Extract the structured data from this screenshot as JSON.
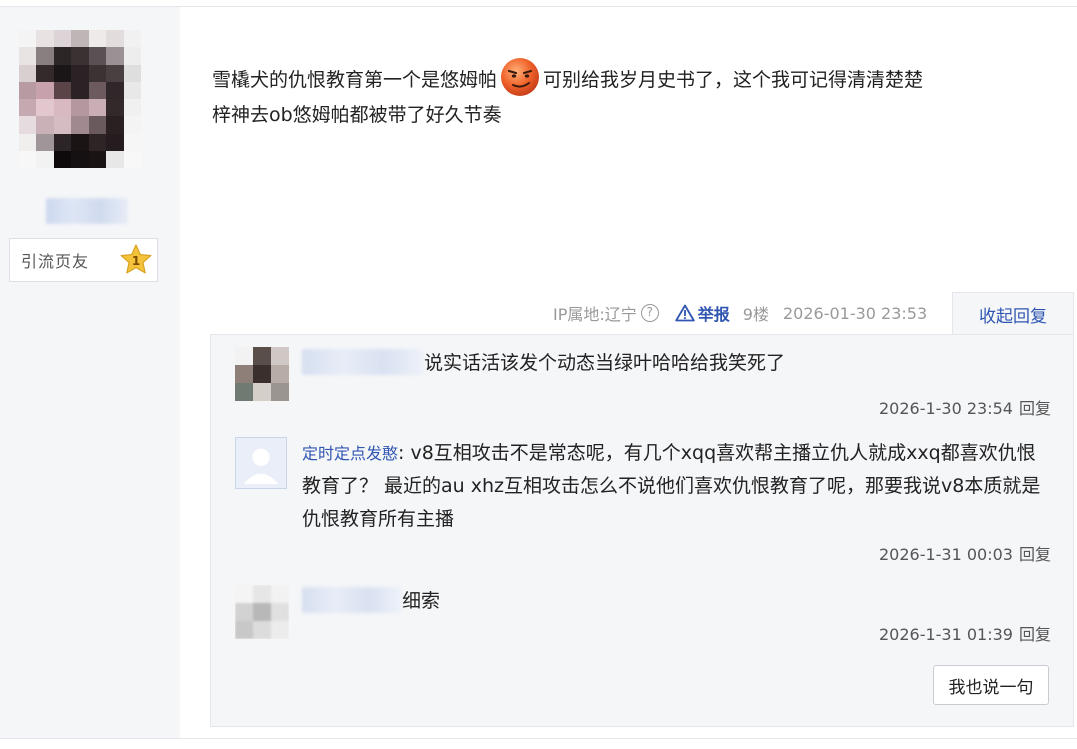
{
  "post": {
    "author": {
      "level_title": "引流页友",
      "level_number": "1"
    },
    "content_part1": "雪橇犬的仇恨教育第一个是悠姆帕",
    "content_part2": "可别给我岁月史书了，这个我可记得清清楚楚",
    "content_line2": "梓神去ob悠姆帕都被带了好久节奏",
    "emoji": "smirk-face-emoji",
    "meta": {
      "ip": "IP属地:辽宁",
      "help_icon": "?",
      "report": "举报",
      "floor": "9楼",
      "time": "2026-01-30 23:53"
    },
    "collapse_label": "收起回复"
  },
  "replies": [
    {
      "name": "",
      "separator": "",
      "text": "说实话活该发个动态当绿叶哈哈给我笑死了",
      "time": "2026-1-30 23:54",
      "reply_label": "回复"
    },
    {
      "name": "定时定点发憨",
      "separator": ": ",
      "text": "v8互相攻击不是常态呢，有几个xqq喜欢帮主播立仇人就成xxq都喜欢仇恨教育了？  最近的au xhz互相攻击怎么不说他们喜欢仇恨教育了呢，那要我说v8本质就是仇恨教育所有主播",
      "time": "2026-1-31 00:03",
      "reply_label": "回复"
    },
    {
      "name": "",
      "separator": "",
      "text": "细索",
      "time": "2026-1-31 01:39",
      "reply_label": "回复"
    }
  ],
  "say_button": "我也说一句",
  "colors": {
    "link_blue": "#3056b2",
    "panel_bg": "#f5f6f8",
    "border": "#e4e6eb",
    "star_gold": "#f5c33b"
  }
}
